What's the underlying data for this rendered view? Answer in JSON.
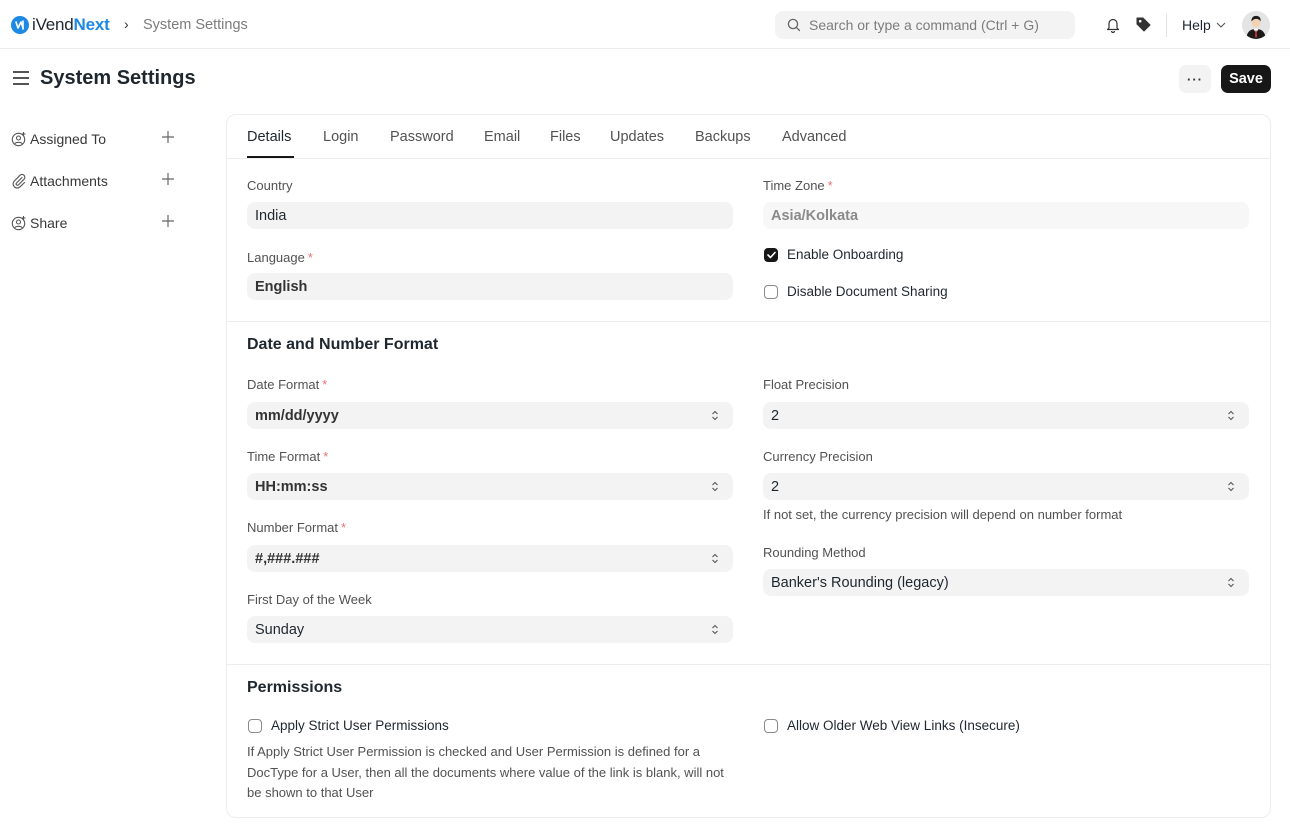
{
  "navbar": {
    "brand_prefix": "iVend",
    "brand_suffix": "Next",
    "breadcrumb_separator": "›",
    "breadcrumb": "System Settings",
    "search_placeholder": "Search or type a command (Ctrl + G)",
    "help_label": "Help",
    "icons": [
      "bell-icon",
      "tag-icon",
      "chevron-down-icon",
      "avatar"
    ]
  },
  "page": {
    "title": "System Settings",
    "more_label": "···",
    "save_label": "Save"
  },
  "sidebar": {
    "items": [
      {
        "label": "Assigned To",
        "icon": "assign-user-icon"
      },
      {
        "label": "Attachments",
        "icon": "paperclip-icon"
      },
      {
        "label": "Share",
        "icon": "share-user-icon"
      }
    ]
  },
  "tabs": [
    {
      "label": "Details",
      "active": true
    },
    {
      "label": "Login",
      "active": false
    },
    {
      "label": "Password",
      "active": false
    },
    {
      "label": "Email",
      "active": false
    },
    {
      "label": "Files",
      "active": false
    },
    {
      "label": "Updates",
      "active": false
    },
    {
      "label": "Backups",
      "active": false
    },
    {
      "label": "Advanced",
      "active": false
    }
  ],
  "details": {
    "country": {
      "label": "Country",
      "value": "India"
    },
    "language": {
      "label": "Language",
      "required": "*",
      "value": "English"
    },
    "time_zone": {
      "label": "Time Zone",
      "required": "*",
      "value": "Asia/Kolkata"
    },
    "enable_onboarding": {
      "label": "Enable Onboarding",
      "checked": true
    },
    "disable_document_sharing": {
      "label": "Disable Document Sharing",
      "checked": false
    }
  },
  "date_number_format": {
    "title": "Date and Number Format",
    "date_format": {
      "label": "Date Format",
      "required": "*",
      "value": "mm/dd/yyyy"
    },
    "time_format": {
      "label": "Time Format",
      "required": "*",
      "value": "HH:mm:ss"
    },
    "number_format": {
      "label": "Number Format",
      "required": "*",
      "value": "#,###.###"
    },
    "first_day_of_week": {
      "label": "First Day of the Week",
      "value": "Sunday"
    },
    "float_precision": {
      "label": "Float Precision",
      "value": "2"
    },
    "currency_precision": {
      "label": "Currency Precision",
      "value": "2",
      "description": "If not set, the currency precision will depend on number format"
    },
    "rounding_method": {
      "label": "Rounding Method",
      "value": "Banker's Rounding (legacy)"
    }
  },
  "permissions": {
    "title": "Permissions",
    "apply_strict": {
      "label": "Apply Strict User Permissions",
      "checked": false,
      "description": "If Apply Strict User Permission is checked and User Permission is defined for a DocType for a User, then all the documents where value of the link is blank, will not be shown to that User"
    },
    "allow_older_links": {
      "label": "Allow Older Web View Links (Insecure)",
      "checked": false
    }
  }
}
